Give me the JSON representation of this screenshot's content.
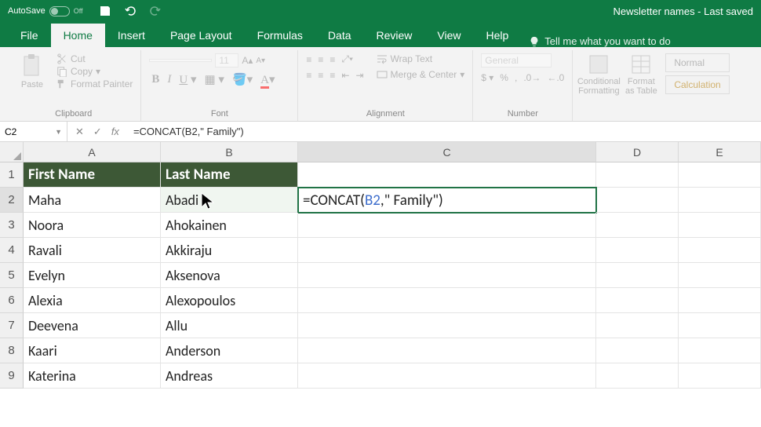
{
  "titlebar": {
    "autosave_label": "AutoSave",
    "autosave_state": "Off",
    "doc_title": "Newsletter names  -  Last saved "
  },
  "tabs": [
    "File",
    "Home",
    "Insert",
    "Page Layout",
    "Formulas",
    "Data",
    "Review",
    "View",
    "Help"
  ],
  "active_tab": "Home",
  "tellme": "Tell me what you want to do",
  "ribbon": {
    "clipboard": {
      "paste": "Paste",
      "cut": "Cut",
      "copy": "Copy",
      "format_painter": "Format Painter",
      "label": "Clipboard"
    },
    "font": {
      "name": "",
      "size": "11",
      "label": "Font"
    },
    "alignment": {
      "wrap": "Wrap Text",
      "merge": "Merge & Center",
      "label": "Alignment"
    },
    "number": {
      "format": "General",
      "label": "Number"
    },
    "styles": {
      "cond": "Conditional Formatting",
      "table": "Format as Table",
      "normal": "Normal",
      "calc": "Calculation"
    }
  },
  "formula_bar": {
    "name_box": "C2",
    "fx_label": "fx",
    "formula": "=CONCAT(B2,\" Family\")"
  },
  "columns": [
    "A",
    "B",
    "C",
    "D",
    "E"
  ],
  "sheet": {
    "headers": {
      "A": "First Name",
      "B": "Last Name"
    },
    "rows": [
      {
        "n": 2,
        "A": "Maha",
        "B": "Abadi",
        "C_formula": "=CONCAT(B2,\" Family\")"
      },
      {
        "n": 3,
        "A": "Noora",
        "B": "Ahokainen"
      },
      {
        "n": 4,
        "A": "Ravali",
        "B": "Akkiraju"
      },
      {
        "n": 5,
        "A": "Evelyn",
        "B": "Aksenova"
      },
      {
        "n": 6,
        "A": "Alexia",
        "B": "Alexopoulos"
      },
      {
        "n": 7,
        "A": "Deevena",
        "B": "Allu"
      },
      {
        "n": 8,
        "A": "Kaari",
        "B": "Anderson"
      },
      {
        "n": 9,
        "A": "Katerina",
        "B": "Andreas"
      }
    ],
    "active_cell": "C2"
  },
  "colors": {
    "brand": "#0f7b44",
    "header_fill": "#3d5836"
  }
}
